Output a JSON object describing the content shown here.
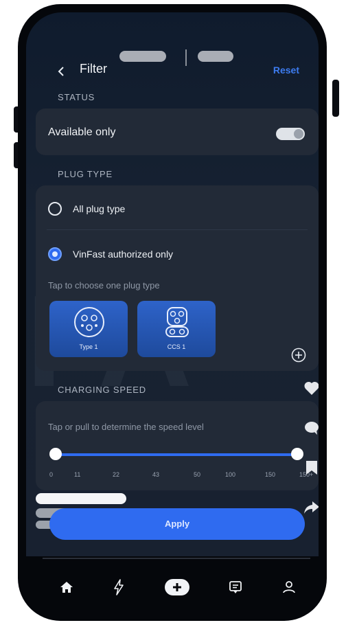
{
  "header": {
    "back_icon": "chevron-left-icon",
    "title": "Filter",
    "reset_label": "Reset"
  },
  "status": {
    "section_label": "STATUS",
    "available_only_label": "Available only",
    "available_only_on": false
  },
  "plug_type": {
    "section_label": "PLUG TYPE",
    "options": [
      {
        "label": "All plug type",
        "selected": false
      },
      {
        "label": "VinFast authorized only",
        "selected": true
      }
    ],
    "hint": "Tap to choose one plug type",
    "plugs": [
      {
        "name": "Type 1",
        "icon": "type1-connector-icon"
      },
      {
        "name": "CCS 1",
        "icon": "ccs1-connector-icon"
      }
    ],
    "add_icon": "plus-circle-icon"
  },
  "charging_speed": {
    "section_label": "CHARGING SPEED",
    "hint": "Tap or pull to determine the speed level",
    "ticks": [
      "0",
      "11",
      "22",
      "43",
      "50",
      "100",
      "150"
    ],
    "range_min": "0",
    "range_max": "150+"
  },
  "side_actions": [
    "heart-icon",
    "comment-icon",
    "bookmark-icon",
    "share-icon"
  ],
  "apply_label": "Apply",
  "tabbar": {
    "items": [
      "home-icon",
      "lightning-icon",
      "plus-icon",
      "message-icon",
      "profile-icon"
    ]
  },
  "colors": {
    "accent": "#2f6bf0",
    "background": "#0f1b2d",
    "card": "#222a37"
  }
}
